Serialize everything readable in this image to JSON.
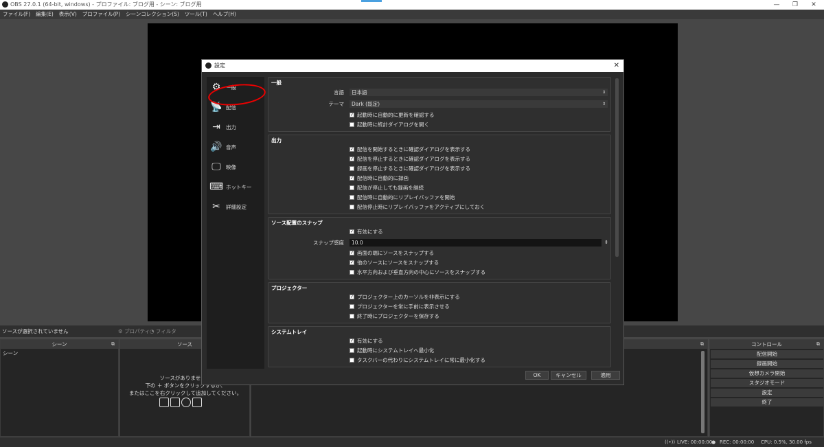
{
  "window": {
    "title": "OBS 27.0.1 (64-bit, windows) - プロファイル: ブログ用 - シーン: ブログ用",
    "minimize": "—",
    "maximize": "❐",
    "close": "✕"
  },
  "menu": [
    "ファイル(F)",
    "編集(E)",
    "表示(V)",
    "プロファイル(P)",
    "シーンコレクション(S)",
    "ツール(T)",
    "ヘルプ(H)"
  ],
  "source_bar": {
    "no_selection": "ソースが選択されていません",
    "properties": "⚙ プロパティ",
    "filters": "◔ フィルタ"
  },
  "docks": {
    "scenes": {
      "title": "シーン",
      "items": [
        "シーン"
      ]
    },
    "sources": {
      "title": "ソース",
      "empty_line1": "ソースがありません。",
      "empty_line2": "下の ＋ ボタンをクリックするか、",
      "empty_line3": "またはここを右クリックして追加してください。"
    },
    "controls": {
      "title": "コントロール",
      "buttons": [
        "配信開始",
        "録画開始",
        "仮想カメラ開始",
        "スタジオモード",
        "設定",
        "終了"
      ]
    }
  },
  "status": {
    "live": "LIVE: 00:00:00",
    "rec": "REC: 00:00:00",
    "cpu": "CPU: 0.5%, 30.00 fps"
  },
  "dialog": {
    "title": "設定",
    "close": "✕",
    "sidebar": [
      {
        "label": "一般",
        "icon": "gear-icon"
      },
      {
        "label": "配信",
        "icon": "antenna-icon"
      },
      {
        "label": "出力",
        "icon": "output-icon"
      },
      {
        "label": "音声",
        "icon": "speaker-icon"
      },
      {
        "label": "映像",
        "icon": "monitor-icon"
      },
      {
        "label": "ホットキー",
        "icon": "keyboard-icon"
      },
      {
        "label": "詳細設定",
        "icon": "tools-icon"
      }
    ],
    "general": {
      "title": "一般",
      "language_label": "言語",
      "language_value": "日本語",
      "theme_label": "テーマ",
      "theme_value": "Dark (既定)",
      "check_updates": "起動時に自動的に更新を確認する",
      "open_stats": "起動時に統計ダイアログを開く"
    },
    "output": {
      "title": "出力",
      "items": [
        {
          "label": "配信を開始するときに確認ダイアログを表示する",
          "checked": true
        },
        {
          "label": "配信を停止するときに確認ダイアログを表示する",
          "checked": true
        },
        {
          "label": "録画を停止するときに確認ダイアログを表示する",
          "checked": false
        },
        {
          "label": "配信時に自動的に録画",
          "checked": true
        },
        {
          "label": "配信が停止しても録画を継続",
          "checked": false
        },
        {
          "label": "配信時に自動的にリプレイバッファを開始",
          "checked": false
        },
        {
          "label": "配信停止時にリプレイバッファをアクティブにしておく",
          "checked": false
        }
      ]
    },
    "snap": {
      "title": "ソース配置のスナップ",
      "enable": "有効にする",
      "sensitivity_label": "スナップ感度",
      "sensitivity_value": "10.0",
      "items": [
        {
          "label": "画面の端にソースをスナップする",
          "checked": true
        },
        {
          "label": "他のソースにソースをスナップする",
          "checked": true
        },
        {
          "label": "水平方向および垂直方向の中心にソースをスナップする",
          "checked": false
        }
      ]
    },
    "projector": {
      "title": "プロジェクター",
      "items": [
        {
          "label": "プロジェクター上のカーソルを非表示にする",
          "checked": true
        },
        {
          "label": "プロジェクターを常に手前に表示させる",
          "checked": false
        },
        {
          "label": "終了時にプロジェクターを保存する",
          "checked": false
        }
      ]
    },
    "tray": {
      "title": "システムトレイ",
      "items": [
        {
          "label": "有効にする",
          "checked": true
        },
        {
          "label": "起動時にシステムトレイへ最小化",
          "checked": false
        },
        {
          "label": "タスクバーの代わりにシステムトレイに常に最小化する",
          "checked": false
        }
      ]
    },
    "buttons": {
      "ok": "OK",
      "cancel": "キャンセル",
      "apply": "適用"
    }
  }
}
